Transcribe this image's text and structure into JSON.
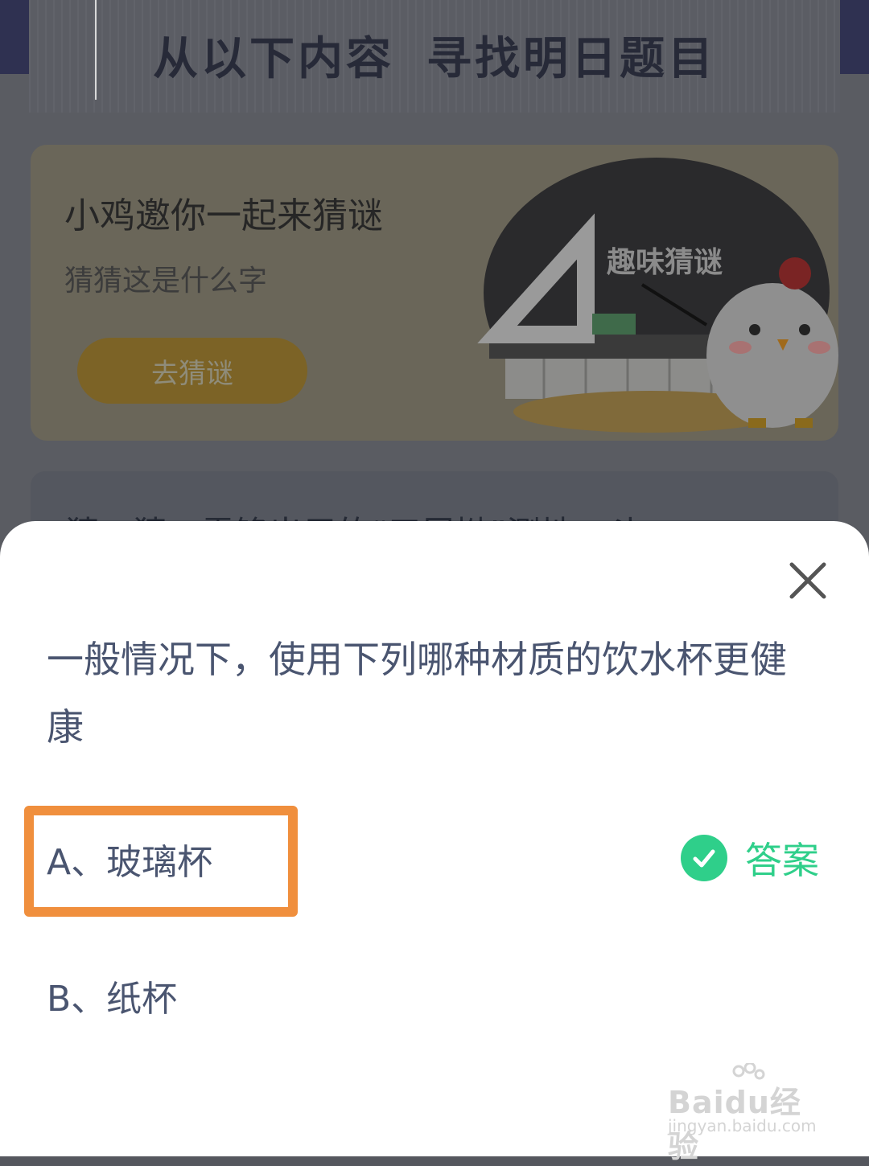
{
  "background": {
    "heading_left": "从以下内容",
    "heading_right": "寻找明日题目",
    "card": {
      "title": "小鸡邀你一起来猜谜",
      "subtitle": "猜猜这是什么字",
      "button_label": "去猜谜",
      "illustration_text": "趣味猜谜"
    },
    "card2_text": "猜一猜：雷锋出用的“三尿拗”测地，斗"
  },
  "dialog": {
    "question": "一般情况下，使用下列哪种材质的饮水杯更健康",
    "options": [
      {
        "label": "A、玻璃杯"
      },
      {
        "label": "B、纸杯"
      }
    ],
    "answer_label": "答案",
    "answer_color": "#2fcf8a",
    "highlight_color": "#f08f3d"
  },
  "watermark": {
    "main": "Baidu经验",
    "sub": "jingyan.baidu.com"
  }
}
